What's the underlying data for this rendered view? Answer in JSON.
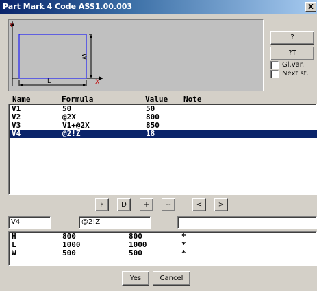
{
  "window": {
    "title": "Part Mark 4 Code ASS1.00.003",
    "close_label": "X"
  },
  "preview": {
    "y_label": "Y",
    "x_label": "X",
    "w_label": "W",
    "l_label": "L"
  },
  "side_buttons": {
    "help": "?",
    "help_t": "?T",
    "global_var": "Gl.var.",
    "next_st": "Next st."
  },
  "columns": [
    "Name",
    "Formula",
    "Value",
    "Note"
  ],
  "variables": [
    {
      "name": "V1",
      "formula": "50",
      "value": "50",
      "note": ""
    },
    {
      "name": "V2",
      "formula": "@2X",
      "value": "800",
      "note": ""
    },
    {
      "name": "V3",
      "formula": "V1+@2X",
      "value": "850",
      "note": ""
    },
    {
      "name": "V4",
      "formula": "@2!Z",
      "value": "18",
      "note": ""
    }
  ],
  "selected_row": 3,
  "toolbar": {
    "f": "F",
    "d": "D",
    "plus": "+",
    "minus": "--",
    "left": "<",
    "right": ">"
  },
  "edit": {
    "name": "V4",
    "formula": "@2!Z",
    "note": ""
  },
  "dimensions": [
    {
      "name": "H",
      "formula": "800",
      "value": "800",
      "flag": "*"
    },
    {
      "name": "L",
      "formula": "1000",
      "value": "1000",
      "flag": "*"
    },
    {
      "name": "W",
      "formula": "500",
      "value": "500",
      "flag": "*"
    }
  ],
  "footer": {
    "yes": "Yes",
    "cancel": "Cancel"
  }
}
